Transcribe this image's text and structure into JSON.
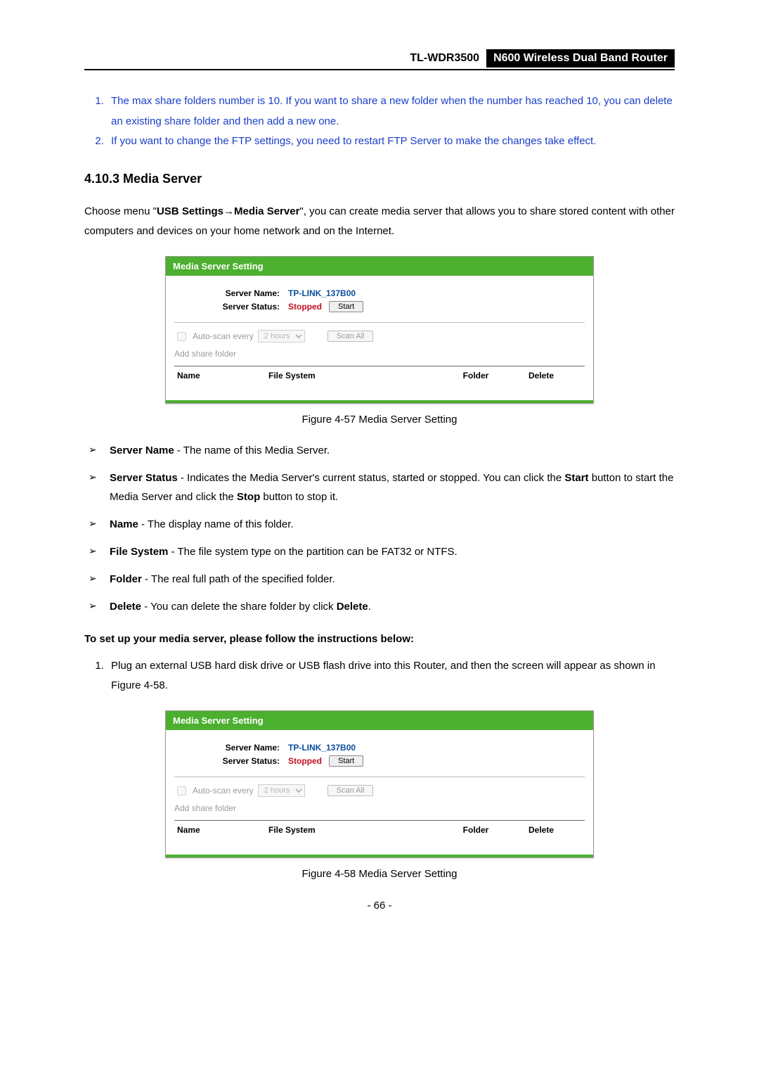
{
  "header": {
    "model": "TL-WDR3500",
    "desc": "N600 Wireless Dual Band Router"
  },
  "notes": [
    "The max share folders number is 10. If you want to share a new folder when the number has reached 10, you can delete an existing share folder and then add a new one.",
    "If you want to change the FTP settings, you need to restart FTP Server to make the changes take effect."
  ],
  "section_heading": "4.10.3  Media Server",
  "intro": {
    "pre": "Choose menu \"",
    "bold1": "USB Settings",
    "arrow": "→",
    "bold2": "Media Server",
    "post": "\", you can create media server that allows you to share stored content with other computers and devices on your home network and on the Internet."
  },
  "panel": {
    "title": "Media Server Setting",
    "server_name_label": "Server Name:",
    "server_name_value": "TP-LINK_137B00",
    "server_status_label": "Server Status:",
    "server_status_value": "Stopped",
    "start_button": "Start",
    "autoscan_label": "Auto-scan every",
    "autoscan_interval": "2 hours",
    "scan_all_button": "Scan All",
    "add_share_folder": "Add share folder",
    "columns": {
      "name": "Name",
      "fs": "File System",
      "folder": "Folder",
      "delete": "Delete"
    }
  },
  "figure57_caption": "Figure 4-57 Media Server Setting",
  "bullets": [
    {
      "term": "Server Name",
      "rest": " - The name of this Media Server."
    },
    {
      "term": "Server Status",
      "rest_pre": " - Indicates the Media Server's current status, started or stopped. You can click the ",
      "mid1": "Start",
      "rest_mid": " button to start the Media Server and click the ",
      "mid2": "Stop",
      "rest_post": " button to stop it."
    },
    {
      "term": "Name",
      "rest": " - The display name of this folder."
    },
    {
      "term": "File System",
      "rest": " - The file system type on the partition can be FAT32 or NTFS."
    },
    {
      "term": "Folder",
      "rest": " - The real full path of the specified folder."
    },
    {
      "term": "Delete",
      "rest_pre": " - You can delete the share folder by click ",
      "mid1": "Delete",
      "rest_post": "."
    }
  ],
  "instructions_heading": "To set up your media server, please follow the instructions below:",
  "step1": "Plug an external USB hard disk drive or USB flash drive into this Router, and then the screen will appear as shown in Figure 4-58.",
  "figure58_caption": "Figure 4-58 Media Server Setting",
  "page_number": "- 66 -"
}
